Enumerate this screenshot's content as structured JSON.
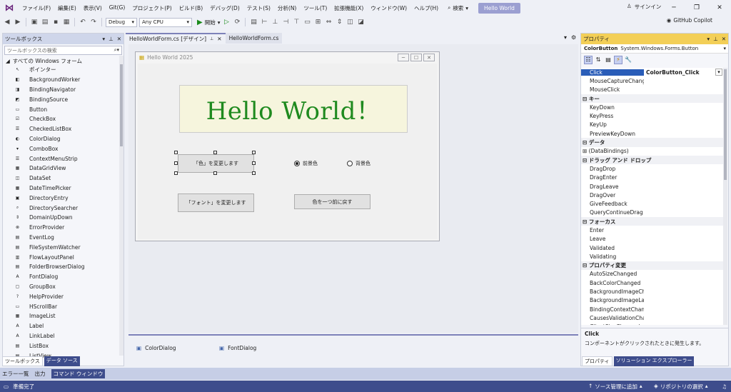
{
  "menu": {
    "items": [
      "ファイル(F)",
      "編集(E)",
      "表示(V)",
      "Git(G)",
      "プロジェクト(P)",
      "ビルド(B)",
      "デバッグ(D)",
      "テスト(S)",
      "分析(N)",
      "ツール(T)",
      "拡張機能(X)",
      "ウィンドウ(W)",
      "ヘルプ(H)"
    ],
    "search_label": "検索",
    "title_chip": "Hello World",
    "signin_label": "サインイン"
  },
  "toolbar": {
    "config_value": "Debug",
    "platform_value": "Any CPU",
    "start_label": "開始",
    "copilot_label": "GitHub Copilot"
  },
  "toolbox": {
    "title": "ツールボックス",
    "search_placeholder": "ツールボックスの検索",
    "category": "すべての Windows フォーム",
    "items": [
      "ポインター",
      "BackgroundWorker",
      "BindingNavigator",
      "BindingSource",
      "Button",
      "CheckBox",
      "CheckedListBox",
      "ColorDialog",
      "ComboBox",
      "ContextMenuStrip",
      "DataGridView",
      "DataSet",
      "DateTimePicker",
      "DirectoryEntry",
      "DirectorySearcher",
      "DomainUpDown",
      "ErrorProvider",
      "EventLog",
      "FileSystemWatcher",
      "FlowLayoutPanel",
      "FolderBrowserDialog",
      "FontDialog",
      "GroupBox",
      "HelpProvider",
      "HScrollBar",
      "ImageList",
      "Label",
      "LinkLabel",
      "ListBox",
      "ListView"
    ],
    "tab_toolbox": "ツールボックス",
    "tab_datasource": "データ ソース"
  },
  "editor": {
    "tab_active": "HelloWorldForm.cs [デザイン]",
    "tab_inactive": "HelloWorldForm.cs",
    "form_title": "Hello World 2025",
    "hello_text": "Hello World！",
    "btn_color": "「色」を変更します",
    "btn_font": "「フォント」を変更します",
    "btn_revert": "色を一つ前に戻す",
    "radio_fore": "前景色",
    "radio_back": "背景色",
    "tray_color": "ColorDialog",
    "tray_font": "FontDialog"
  },
  "properties": {
    "title": "プロパティ",
    "object_name": "ColorButton",
    "object_type": "System.Windows.Forms.Button",
    "rows": [
      {
        "kind": "row",
        "name": "Click",
        "value": "ColorButton_Click",
        "selected": true
      },
      {
        "kind": "row",
        "name": "MouseCaptureChanged",
        "value": ""
      },
      {
        "kind": "row",
        "name": "MouseClick",
        "value": ""
      },
      {
        "kind": "cat",
        "name": "キー"
      },
      {
        "kind": "row",
        "name": "KeyDown",
        "value": ""
      },
      {
        "kind": "row",
        "name": "KeyPress",
        "value": ""
      },
      {
        "kind": "row",
        "name": "KeyUp",
        "value": ""
      },
      {
        "kind": "row",
        "name": "PreviewKeyDown",
        "value": ""
      },
      {
        "kind": "cat",
        "name": "データ"
      },
      {
        "kind": "row",
        "name": "(DataBindings)",
        "value": "",
        "expand": true
      },
      {
        "kind": "cat",
        "name": "ドラッグ アンド ドロップ"
      },
      {
        "kind": "row",
        "name": "DragDrop",
        "value": ""
      },
      {
        "kind": "row",
        "name": "DragEnter",
        "value": ""
      },
      {
        "kind": "row",
        "name": "DragLeave",
        "value": ""
      },
      {
        "kind": "row",
        "name": "DragOver",
        "value": ""
      },
      {
        "kind": "row",
        "name": "GiveFeedback",
        "value": ""
      },
      {
        "kind": "row",
        "name": "QueryContinueDrag",
        "value": ""
      },
      {
        "kind": "cat",
        "name": "フォーカス"
      },
      {
        "kind": "row",
        "name": "Enter",
        "value": ""
      },
      {
        "kind": "row",
        "name": "Leave",
        "value": ""
      },
      {
        "kind": "row",
        "name": "Validated",
        "value": ""
      },
      {
        "kind": "row",
        "name": "Validating",
        "value": ""
      },
      {
        "kind": "cat",
        "name": "プロパティ変更"
      },
      {
        "kind": "row",
        "name": "AutoSizeChanged",
        "value": ""
      },
      {
        "kind": "row",
        "name": "BackColorChanged",
        "value": ""
      },
      {
        "kind": "row",
        "name": "BackgroundImageChang",
        "value": ""
      },
      {
        "kind": "row",
        "name": "BackgroundImageLayou",
        "value": ""
      },
      {
        "kind": "row",
        "name": "BindingContextChanged",
        "value": ""
      },
      {
        "kind": "row",
        "name": "CausesValidationChange",
        "value": ""
      },
      {
        "kind": "row",
        "name": "ClientSizeChanged",
        "value": ""
      }
    ],
    "desc_title": "Click",
    "desc_text": "コンポーネントがクリックされたときに発生します。",
    "tab_props": "プロパティ",
    "tab_solution": "ソリューション エクスプローラー"
  },
  "bottom": {
    "tabs": [
      "エラー一覧",
      "出力",
      "コマンド ウィンドウ"
    ]
  },
  "status": {
    "ready": "準備完了",
    "source_control": "ソース管理に追加",
    "repo": "リポジトリの選択"
  },
  "colors": {
    "accent": "#68217a",
    "statusbar": "#3e4d8c",
    "hello_green": "#1f8a1f",
    "props_header": "#f3cf57"
  }
}
